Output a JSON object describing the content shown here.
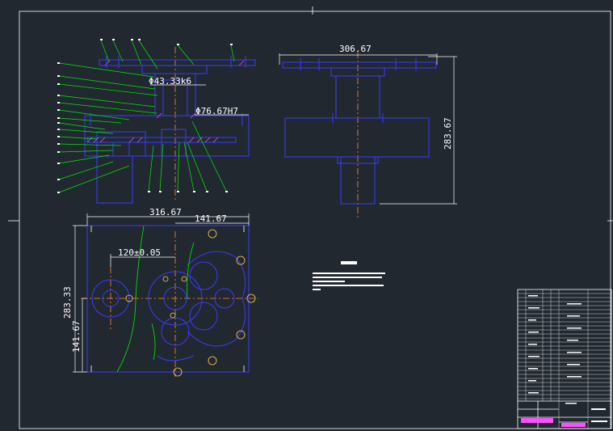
{
  "colors": {
    "background": "#212830",
    "frame": "#ffffff",
    "outline": "#3b3bff",
    "leader": "#00ee00",
    "dimension": "#ffffff",
    "centerline": "#ff8a33",
    "hatch": "#ff4dff",
    "bolt": "#ffd24a"
  },
  "dimensions": {
    "fit_shaft": "Φ43.33k6",
    "fit_bore": "Φ76.67H7",
    "top_width": "306.67",
    "side_height": "283.67",
    "plan_width": "316.67",
    "plan_half_width": "141.67",
    "plan_center_distance": "120±0.05",
    "plan_height": "283.33",
    "plan_half_height": "141.67"
  }
}
